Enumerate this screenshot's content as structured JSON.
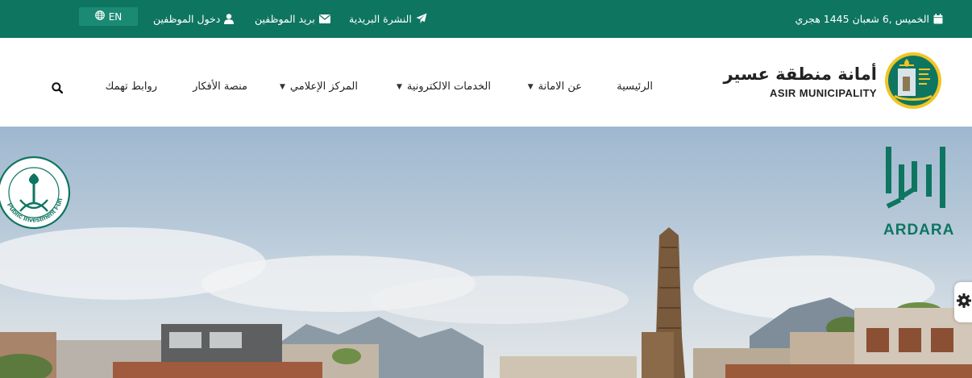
{
  "topbar": {
    "date": "الخميس ,6 شعبان 1445 هجري",
    "newsletter": "النشرة البريدية",
    "employee_mail": "بريد الموظفين",
    "employee_login": "دخول الموظفين",
    "language": "EN"
  },
  "header": {
    "logo_ar": "أمانة منطقة عسير",
    "logo_en": "ASIR MUNICIPALITY",
    "nav": {
      "home": "الرئيسية",
      "about": "عن الامانة",
      "eservices": "الخدمات الالكترونية",
      "media": "المركز الإعلامي",
      "ideas": "منصة الأفكار",
      "links": "روابط تهمك"
    }
  },
  "hero": {
    "pif_text": "Public Investment Fund",
    "ardara_text": "ARDARA"
  },
  "colors": {
    "brand_green": "#0e7561",
    "lang_button": "#1b8a74"
  },
  "icons": [
    "calendar-icon",
    "paper-plane-icon",
    "envelope-icon",
    "user-icon",
    "globe-icon",
    "chevron-down-icon",
    "search-icon",
    "gear-icon"
  ]
}
